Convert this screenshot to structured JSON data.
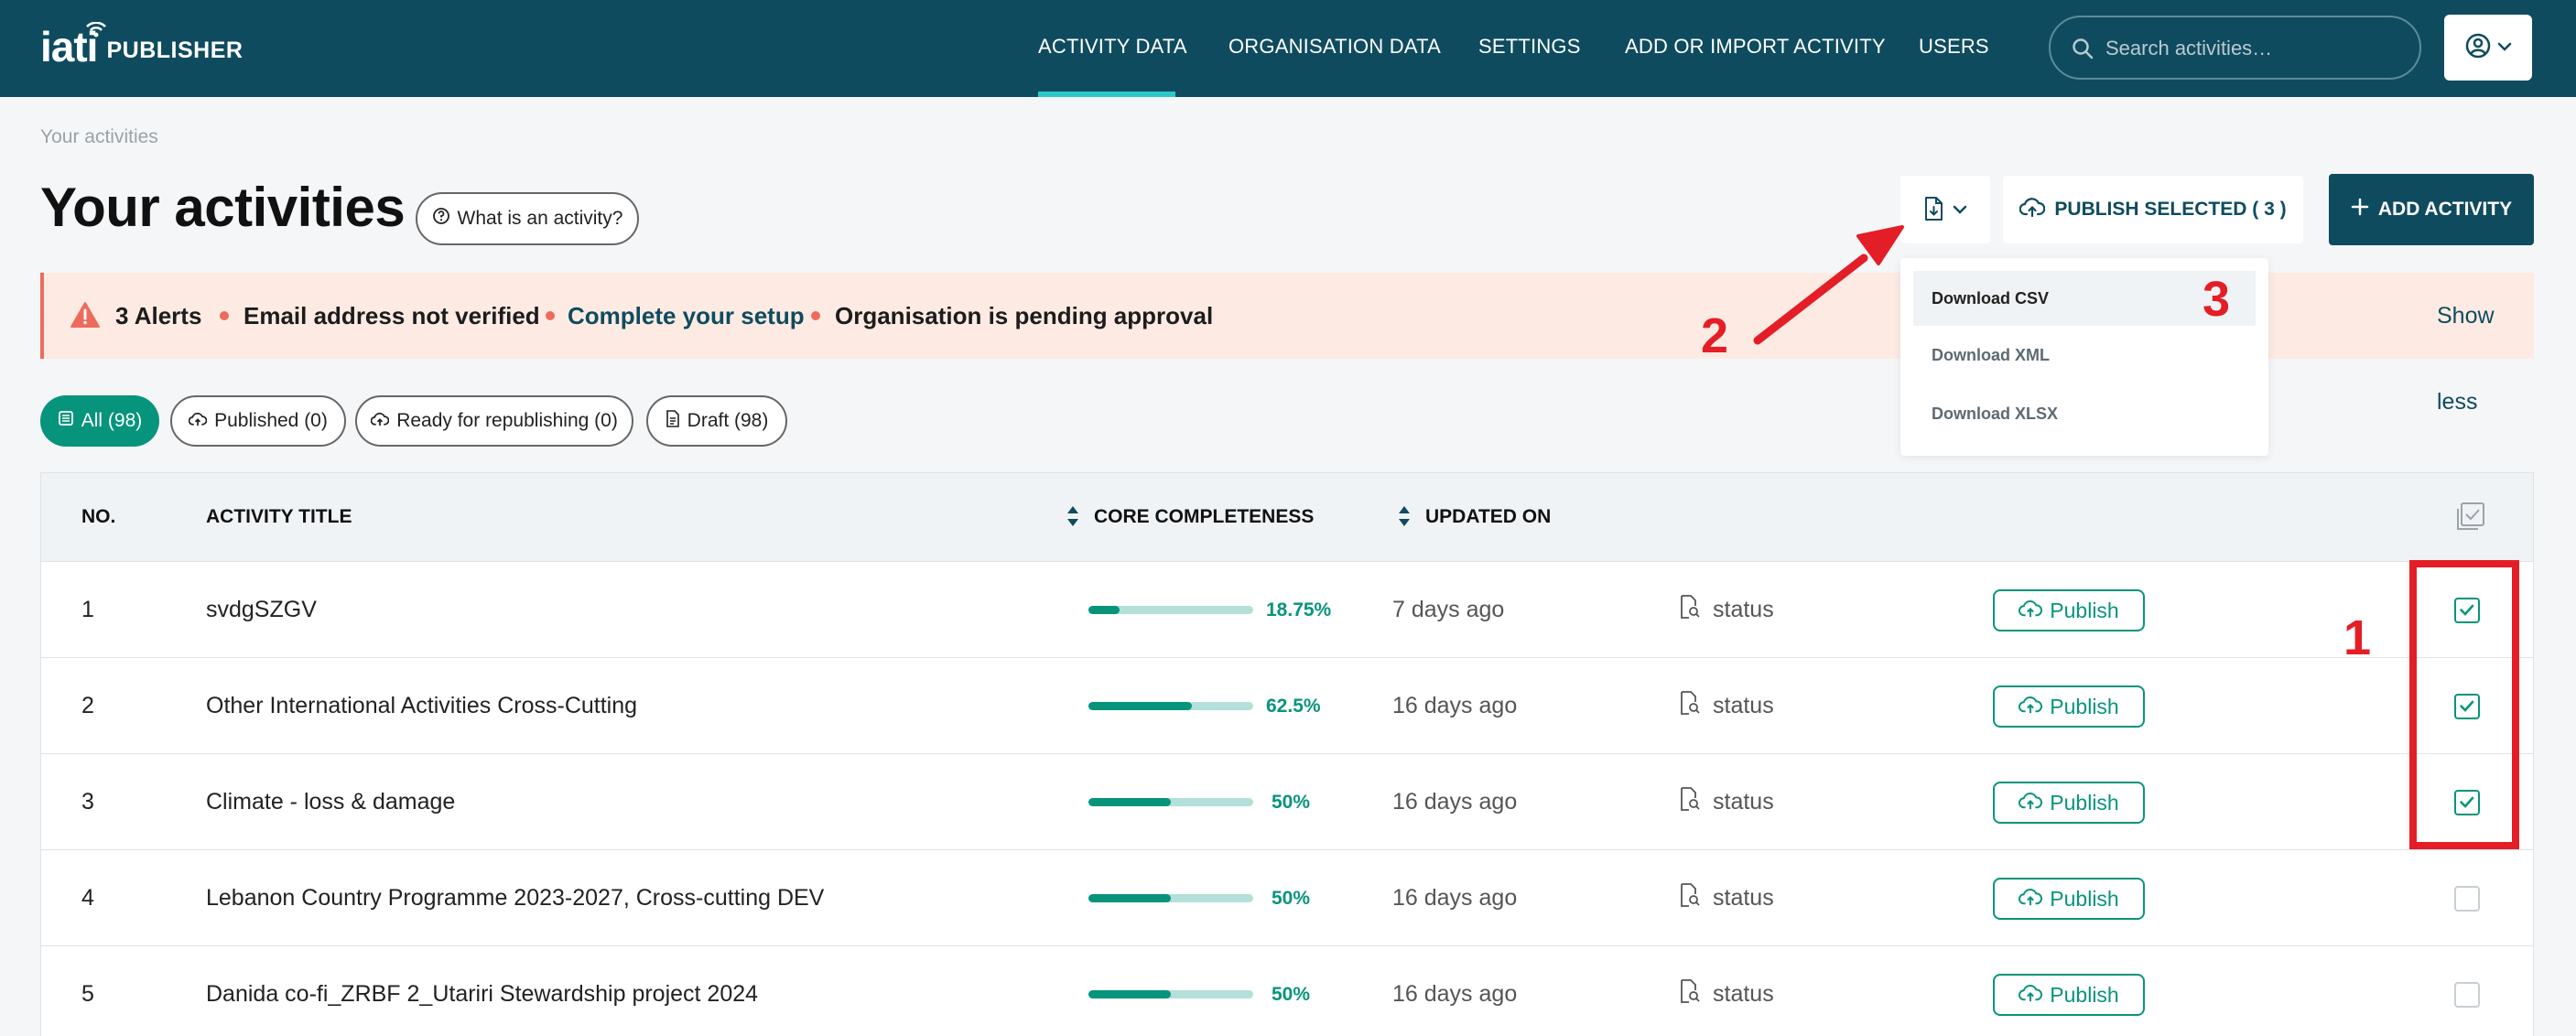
{
  "header": {
    "logo_iati": "iati",
    "logo_publisher": "PUBLISHER",
    "nav": [
      "ACTIVITY DATA",
      "ORGANISATION DATA",
      "SETTINGS",
      "ADD OR IMPORT ACTIVITY",
      "USERS"
    ],
    "active_nav": "ACTIVITY DATA",
    "search_placeholder": "Search activities…"
  },
  "breadcrumb": "Your activities",
  "page_title": "Your activities",
  "what_is_activity": "What is an activity?",
  "toolbar": {
    "publish_selected": "PUBLISH SELECTED ( 3 )",
    "add_activity": "ADD ACTIVITY"
  },
  "download_menu": [
    "Download CSV",
    "Download XML",
    "Download XLSX"
  ],
  "alerts": {
    "count": "3 Alerts",
    "items": [
      "Email address not verified",
      "Complete your setup",
      "Organisation is pending approval"
    ],
    "show_less": "Show less"
  },
  "filters": [
    "All (98)",
    "Published (0)",
    "Ready for republishing (0)",
    "Draft (98)"
  ],
  "table": {
    "headers": {
      "no": "NO.",
      "title": "ACTIVITY TITLE",
      "completeness": "CORE COMPLETENESS",
      "updated": "UPDATED ON"
    },
    "status_label": "status",
    "publish_label": "Publish",
    "rows": [
      {
        "no": "1",
        "title": "svdgSZGV",
        "completeness": 18.75,
        "pct": "18.75%",
        "updated": "7 days ago",
        "checked": true
      },
      {
        "no": "2",
        "title": "Other International Activities Cross-Cutting",
        "completeness": 62.5,
        "pct": "62.5%",
        "updated": "16 days ago",
        "checked": true
      },
      {
        "no": "3",
        "title": "Climate - loss & damage",
        "completeness": 50,
        "pct": "50%",
        "updated": "16 days ago",
        "checked": true
      },
      {
        "no": "4",
        "title": "Lebanon Country Programme 2023-2027, Cross-cutting DEV",
        "completeness": 50,
        "pct": "50%",
        "updated": "16 days ago",
        "checked": false
      },
      {
        "no": "5",
        "title": "Danida co-fi_ZRBF 2_Utariri Stewardship project 2024",
        "completeness": 50,
        "pct": "50%",
        "updated": "16 days ago",
        "checked": false
      }
    ]
  },
  "annotations": [
    "1",
    "2",
    "3"
  ],
  "colors": {
    "header_bg": "#0f4b5f",
    "accent": "#07947c",
    "alert_bg": "#fdebe3",
    "annotation_red": "#e41e26"
  }
}
